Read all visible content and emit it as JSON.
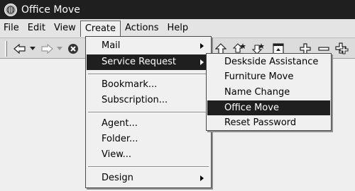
{
  "window": {
    "title": "Office Move",
    "icon": "app-globe-icon"
  },
  "menubar": {
    "items": [
      {
        "label": "File"
      },
      {
        "label": "Edit"
      },
      {
        "label": "View"
      },
      {
        "label": "Create"
      },
      {
        "label": "Actions"
      },
      {
        "label": "Help"
      }
    ],
    "open_menu": "Create"
  },
  "toolbar": {
    "buttons": [
      "back-arrow-icon",
      "dropdown-arrow-icon",
      "forward-arrow-icon",
      "dropdown-arrow-icon",
      "stop-icon",
      "up-arrow-icon",
      "expand-icon",
      "collapse-icon",
      "document-icon",
      "plus-icon",
      "minus-icon",
      "expand-all-icon"
    ]
  },
  "create_menu": {
    "items": [
      {
        "label": "Mail",
        "has_submenu": true
      },
      {
        "label": "Service Request",
        "has_submenu": true,
        "highlighted": true
      },
      {
        "label": "Bookmark..."
      },
      {
        "label": "Subscription..."
      },
      {
        "label": "Agent..."
      },
      {
        "label": "Folder..."
      },
      {
        "label": "View..."
      },
      {
        "label": "Design",
        "has_submenu": true
      }
    ]
  },
  "service_request_menu": {
    "items": [
      {
        "label": "Deskside Assistance"
      },
      {
        "label": "Furniture Move"
      },
      {
        "label": "Name Change"
      },
      {
        "label": "Office Move",
        "highlighted": true
      },
      {
        "label": "Reset Password"
      }
    ]
  },
  "colors": {
    "highlight": "#1f1f1f",
    "menu_bg": "#f0f0f0",
    "titlebar": "#1f1f1f"
  }
}
